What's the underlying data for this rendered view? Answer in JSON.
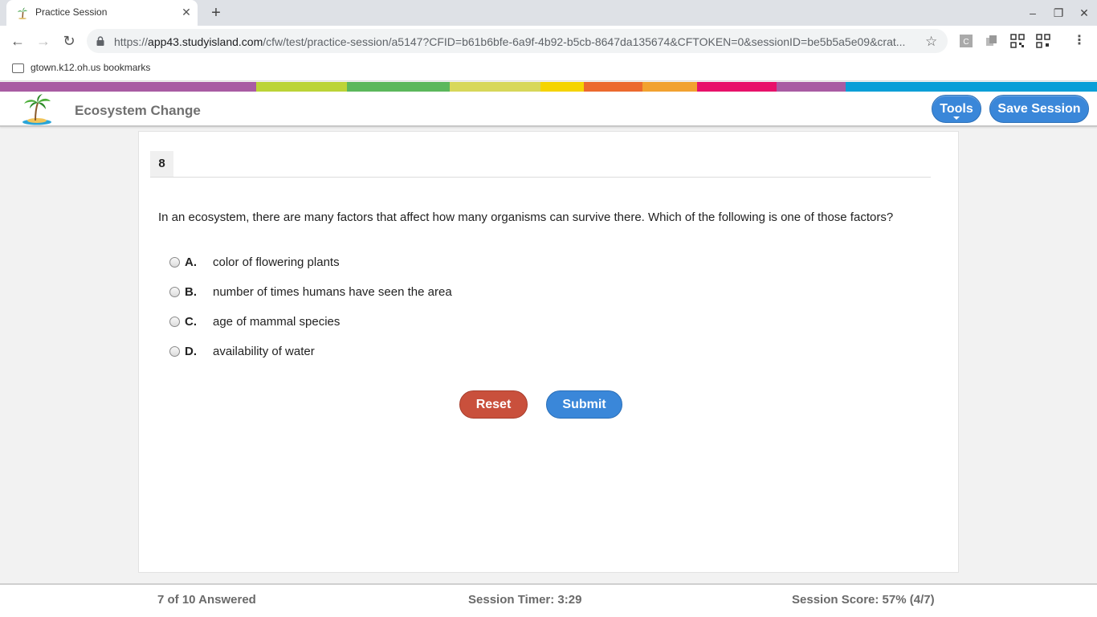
{
  "browser": {
    "tab_title": "Practice Session",
    "url_prefix": "https://",
    "url_host": "app43.studyisland.com",
    "url_path": "/cfw/test/practice-session/a5147?CFID=b61b6bfe-6a9f-4b92-b5cb-8647da135674&CFTOKEN=0&sessionID=be5b5a5e09&crat...",
    "bookmark_folder": "gtown.k12.oh.us bookmarks"
  },
  "stripe_colors": [
    "#a95ca3",
    "#bcd437",
    "#5cb85c",
    "#d8d85a",
    "#f5d400",
    "#ec6a2e",
    "#f2a230",
    "#e8126a",
    "#a95ca3",
    "#0a9fd8"
  ],
  "header": {
    "title": "Ecosystem Change",
    "tools_label": "Tools",
    "save_label": "Save Session"
  },
  "question": {
    "number": "8",
    "text": "In an ecosystem, there are many factors that affect how many organisms can survive there. Which of the following is one of those factors?",
    "choices": [
      {
        "letter": "A.",
        "text": "color of flowering plants"
      },
      {
        "letter": "B.",
        "text": "number of times humans have seen the area"
      },
      {
        "letter": "C.",
        "text": "age of mammal species"
      },
      {
        "letter": "D.",
        "text": "availability of water"
      }
    ],
    "reset_label": "Reset",
    "submit_label": "Submit"
  },
  "footer": {
    "answered": "7 of 10 Answered",
    "timer": "Session Timer: 3:29",
    "score": "Session Score: 57% (4/7)"
  }
}
